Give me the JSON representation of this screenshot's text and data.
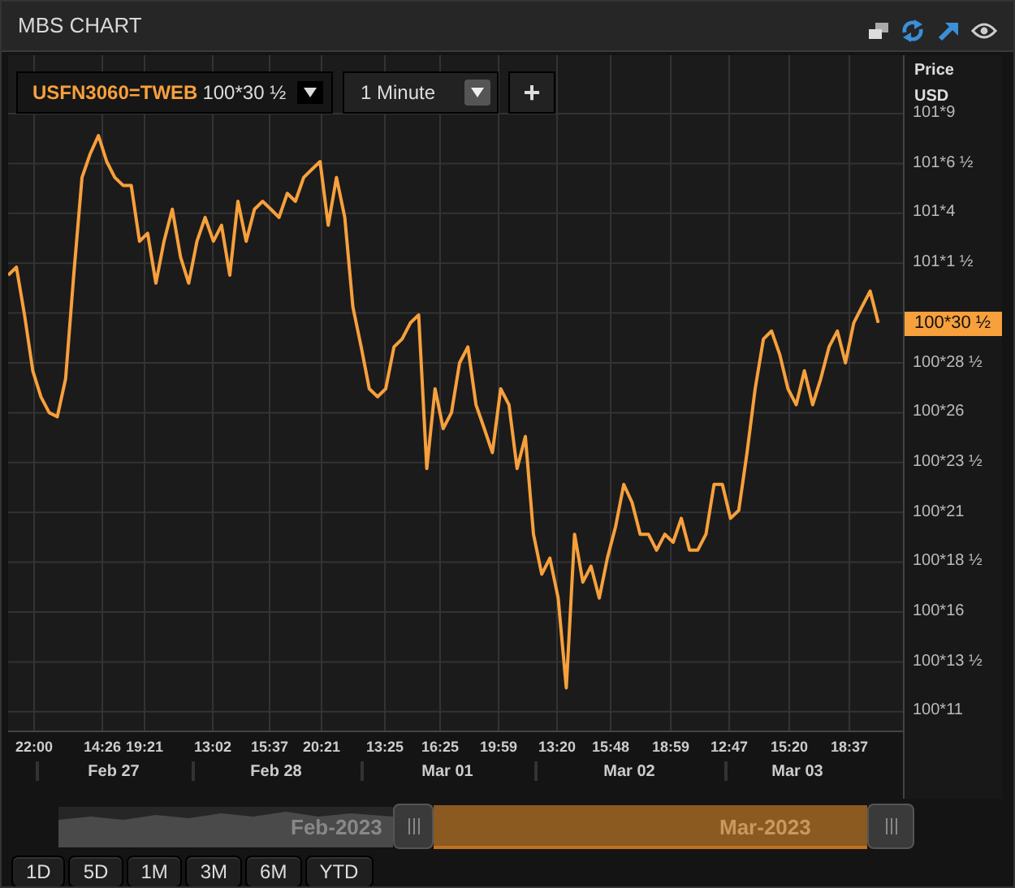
{
  "window": {
    "title": "MBS CHART"
  },
  "toolbar": {
    "instrument": {
      "price": "100*30 ½"
    },
    "interval": {
      "value": "1 Minute"
    },
    "add_button": "+"
  },
  "instrument_name": "USFN3060=TWEB",
  "price_axis": {
    "title": "Price",
    "currency": "USD",
    "current_price": "100*30 ½",
    "labels": [
      "101*9",
      "101*6 ½",
      "101*4",
      "101*1 ½",
      "100*28 ½",
      "100*26",
      "100*23 ½",
      "100*21",
      "100*18 ½",
      "100*16",
      "100*13 ½",
      "100*11"
    ]
  },
  "time_axis": [
    "22:00",
    "14:26",
    "19:21",
    "13:02",
    "15:37",
    "20:21",
    "13:25",
    "16:25",
    "19:59",
    "13:20",
    "15:48",
    "18:59",
    "12:47",
    "15:20",
    "18:37"
  ],
  "date_axis": [
    "Feb 27",
    "Feb 28",
    "Mar 01",
    "Mar 02",
    "Mar 03"
  ],
  "navigator": {
    "labels": [
      "Feb-2023",
      "Mar-2023"
    ]
  },
  "range_buttons": [
    "1D",
    "5D",
    "1M",
    "3M",
    "6M",
    "YTD"
  ]
}
